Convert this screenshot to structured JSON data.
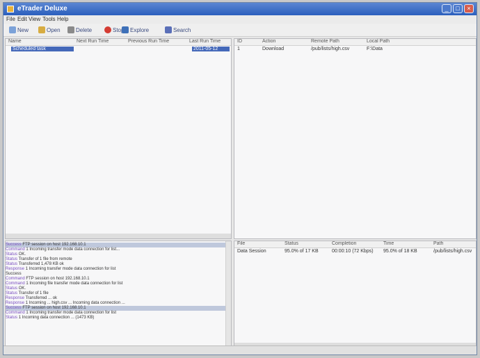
{
  "window": {
    "title": "eTrader Deluxe"
  },
  "menu": [
    "File",
    "Edit",
    "View",
    "Tools",
    "Help"
  ],
  "toolbar": {
    "items": [
      "New",
      "Open",
      "Delete",
      "Stop",
      "Explore",
      "Search"
    ]
  },
  "left_pane": {
    "columns": [
      "Name",
      "Next Run Time",
      "Previous Run Time",
      "Last Run Time"
    ],
    "rows": [
      {
        "name": "Scheduled task",
        "next": "",
        "prev": "",
        "last": "2011-05-12"
      }
    ]
  },
  "right_pane": {
    "columns": [
      "ID",
      "Action",
      "Remote Path",
      "Local Path"
    ],
    "rows": [
      {
        "id": "1",
        "action": "Download",
        "remote": "/pub/lists/high.csv",
        "local": "F:\\Data"
      }
    ]
  },
  "log": {
    "lines": [
      {
        "time": "Success",
        "text": "FTP session on host 192.168.10.1"
      },
      {
        "time": "Command",
        "text": "1 Incoming transfer mode data connection for list..."
      },
      {
        "time": "Status",
        "text": "OK."
      },
      {
        "time": "Status",
        "text": "Transfer of 1 file from remote"
      },
      {
        "time": "Status",
        "text": "Transferred 1,478 KB ok"
      },
      {
        "time": "Response",
        "text": "1 Incoming transfer mode data connection for list"
      },
      {
        "time": "",
        "text": "Success"
      },
      {
        "time": "Command",
        "text": "FTP session on host 192.168.10.1"
      },
      {
        "time": "Command",
        "text": "1 Incoming file transfer mode data connection for list"
      },
      {
        "time": "Status",
        "text": "OK."
      },
      {
        "time": "Status",
        "text": "Transfer of 1 file"
      },
      {
        "time": "Response",
        "text": "Transferred ... ok"
      },
      {
        "time": "Response",
        "text": "1 Incoming ... high.csv ... Incoming data connection ..."
      },
      {
        "time": "Success",
        "text": "FTP session on host 192.168.10.1"
      },
      {
        "time": "Command",
        "text": "1 Incoming transfer mode data connection for list"
      },
      {
        "time": "Status",
        "text": "1 Incoming data connection ... (1473 KB)"
      }
    ]
  },
  "transfers": {
    "columns": [
      "File",
      "Status",
      "Completion",
      "Time",
      "Path"
    ],
    "rows": [
      {
        "file": "Data Session",
        "status": "95.0% of 17 KB",
        "completion": "00:00:10 (72 Kbps)",
        "time": "95.0% of 18 KB",
        "path": "/pub/lists/high.csv"
      }
    ]
  },
  "status": {
    "text": ""
  }
}
